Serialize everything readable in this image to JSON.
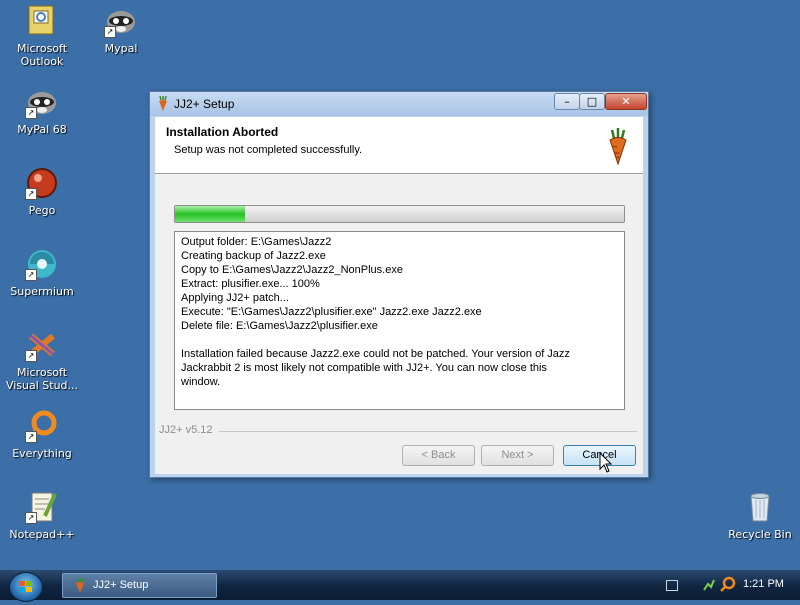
{
  "desktop": {
    "icons": [
      {
        "label_1": "Microsoft",
        "label_2": "Outlook"
      },
      {
        "label_1": "Mypal",
        "label_2": ""
      },
      {
        "label_1": "MyPal 68",
        "label_2": ""
      },
      {
        "label_1": "Pego",
        "label_2": ""
      },
      {
        "label_1": "Supermium",
        "label_2": ""
      },
      {
        "label_1": "Microsoft",
        "label_2": "Visual Stud..."
      },
      {
        "label_1": "Everything",
        "label_2": ""
      },
      {
        "label_1": "Notepad++",
        "label_2": ""
      },
      {
        "label_1": "Recycle Bin",
        "label_2": ""
      }
    ]
  },
  "window": {
    "title": "JJ2+ Setup",
    "header": {
      "title": "Installation Aborted",
      "subtitle": "Setup was not completed successfully."
    },
    "progress_fraction": 0.155,
    "log_lines": [
      "Output folder: E:\\Games\\Jazz2",
      "Creating backup of Jazz2.exe",
      "Copy to E:\\Games\\Jazz2\\Jazz2_NonPlus.exe",
      "Extract: plusifier.exe... 100%",
      "Applying JJ2+ patch...",
      "Execute: \"E:\\Games\\Jazz2\\plusifier.exe\" Jazz2.exe Jazz2.exe",
      "Delete file: E:\\Games\\Jazz2\\plusifier.exe"
    ],
    "log_message": "Installation failed because Jazz2.exe could not be patched. Your version of Jazz Jackrabbit 2 is most likely not compatible with JJ2+. You can now close this window.",
    "branding": "JJ2+ v5.12",
    "buttons": {
      "back": "< Back",
      "next": "Next >",
      "cancel": "Cancel"
    },
    "controls": {
      "minimize": "–",
      "maximize": "□",
      "close": "✕"
    }
  },
  "taskbar": {
    "task_label": "JJ2+ Setup",
    "clock": "1:21 PM"
  },
  "colors": {
    "desktop": "#3c6fa8",
    "progress_green": "#27c027",
    "taskbar": "#0f2540"
  }
}
